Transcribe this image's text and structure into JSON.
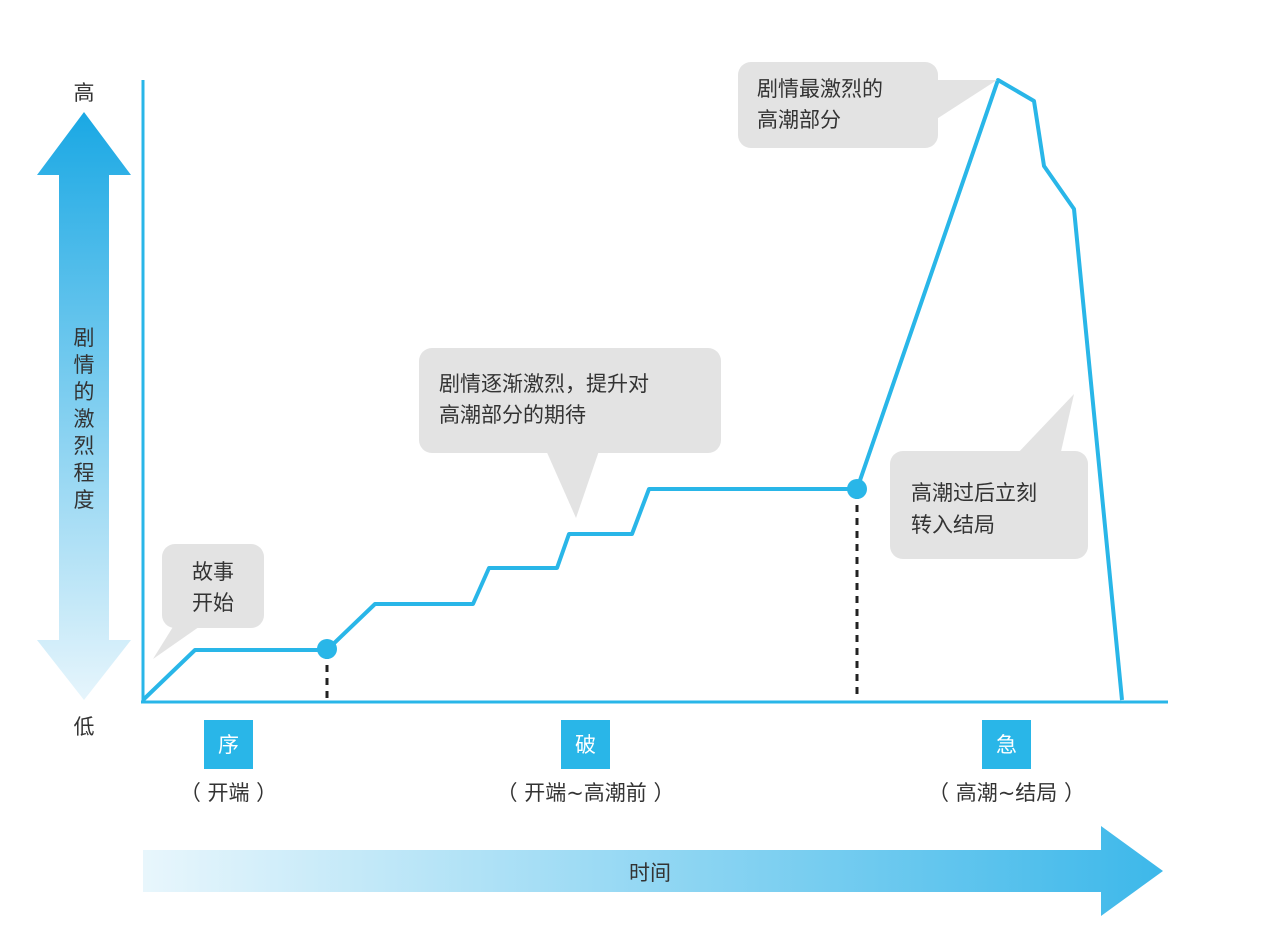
{
  "colors": {
    "curve": "#29b6e8",
    "axis": "#29b6e8",
    "callout_fill": "#e3e3e3",
    "phase_box": "#29b6e8",
    "phase_box_text": "#ffffff",
    "text": "#333333",
    "arrow_dark": "#1aa8e4",
    "arrow_light": "#e8f6fc"
  },
  "y_axis": {
    "top_label": "高",
    "bottom_label": "低",
    "title": "剧情的激烈程度"
  },
  "x_axis": {
    "title": "时间"
  },
  "phases": [
    {
      "box": "序",
      "caption": "（ 开端 ）"
    },
    {
      "box": "破",
      "caption": "（ 开端~高潮前 ）"
    },
    {
      "box": "急",
      "caption": "（ 高潮~结局 ）"
    }
  ],
  "callouts": [
    {
      "line1": "故事",
      "line2": "开始"
    },
    {
      "line1": "剧情逐渐激烈，提升对",
      "line2": "高潮部分的期待"
    },
    {
      "line1": "剧情最激烈的",
      "line2": "高潮部分"
    },
    {
      "line1": "高潮过后立刻",
      "line2": "转入结局"
    }
  ]
}
